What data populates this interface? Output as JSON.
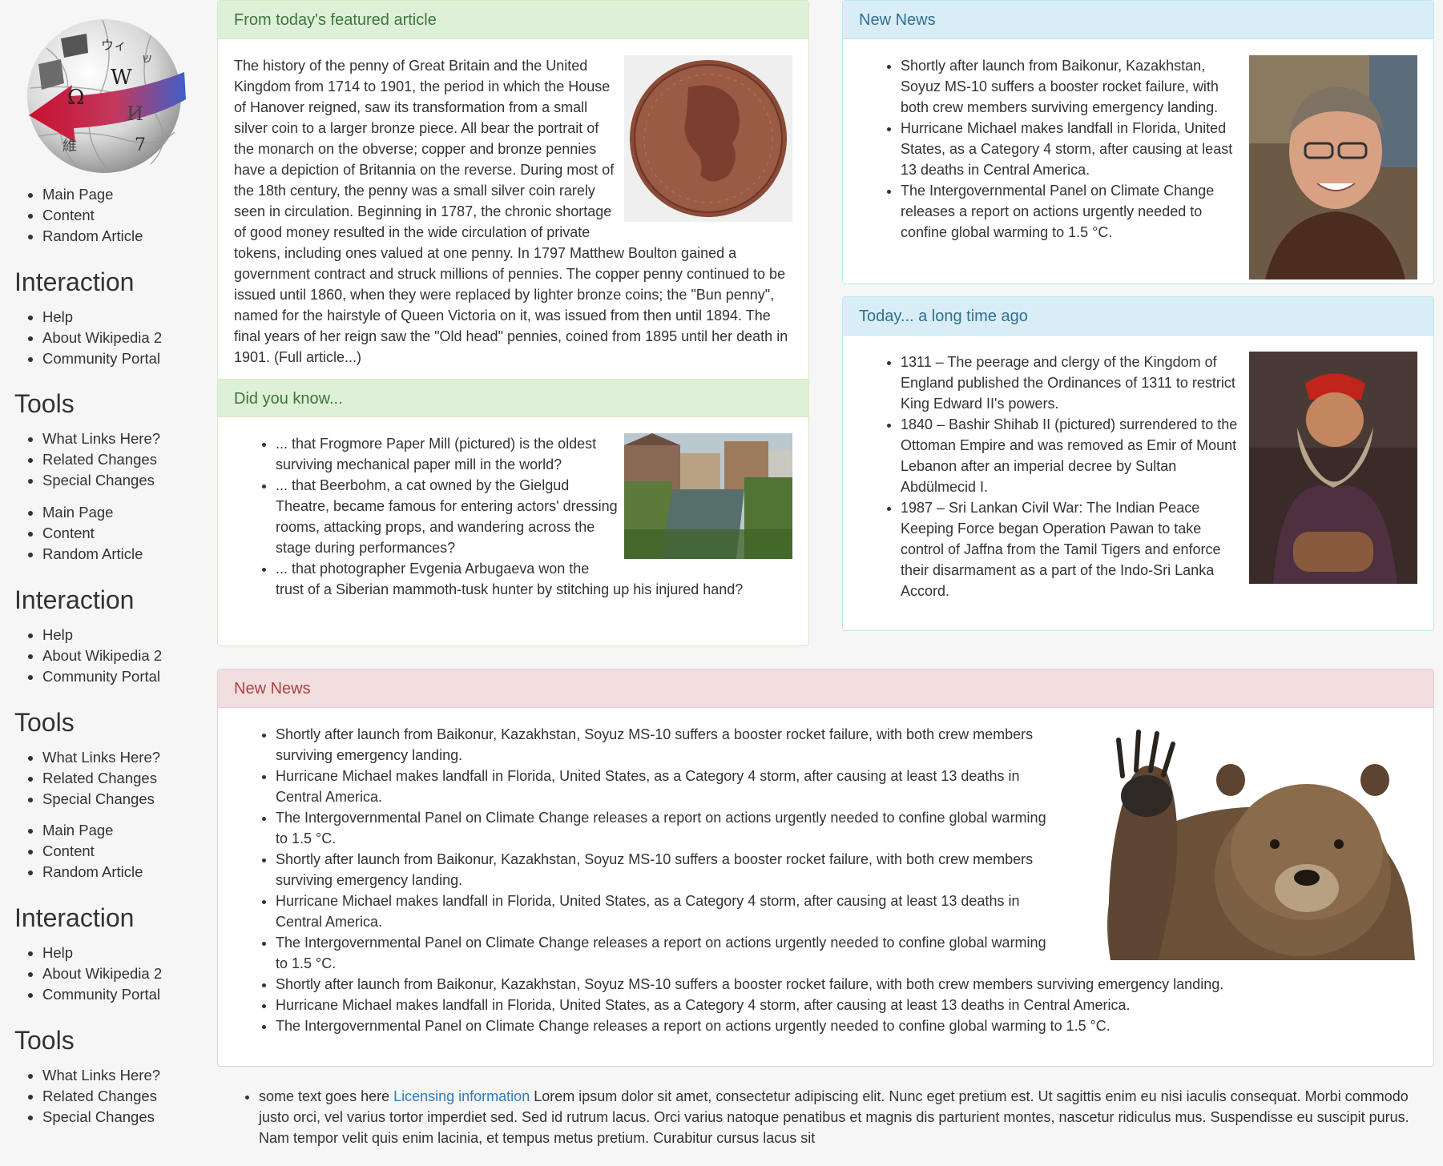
{
  "sidebar": {
    "groups": [
      {
        "links": [
          "Main Page",
          "Content",
          "Random Article"
        ],
        "interaction_title": "Interaction",
        "interaction_links": [
          "Help",
          "About Wikipedia 2",
          "Community Portal"
        ],
        "tools_title": "Tools",
        "tools_links": [
          "What Links Here?",
          "Related Changes",
          "Special Changes"
        ]
      },
      {
        "links": [
          "Main Page",
          "Content",
          "Random Article"
        ],
        "interaction_title": "Interaction",
        "interaction_links": [
          "Help",
          "About Wikipedia 2",
          "Community Portal"
        ],
        "tools_title": "Tools",
        "tools_links": [
          "What Links Here?",
          "Related Changes",
          "Special Changes"
        ]
      },
      {
        "links": [
          "Main Page",
          "Content",
          "Random Article"
        ],
        "interaction_title": "Interaction",
        "interaction_links": [
          "Help",
          "About Wikipedia 2",
          "Community Portal"
        ],
        "tools_title": "Tools",
        "tools_links": [
          "What Links Here?",
          "Related Changes",
          "Special Changes"
        ]
      }
    ]
  },
  "featured": {
    "title": "From today's featured article",
    "text": "The history of the penny of Great Britain and the United Kingdom from 1714 to 1901, the period in which the House of Hanover reigned, saw its transformation from a small silver coin to a larger bronze piece. All bear the portrait of the monarch on the obverse; copper and bronze pennies have a depiction of Britannia on the reverse. During most of the 18th century, the penny was a small silver coin rarely seen in circulation. Beginning in 1787, the chronic shortage of good money resulted in the wide circulation of private tokens, including ones valued at one penny. In 1797 Matthew Boulton gained a government contract and struck millions of pennies. The copper penny continued to be issued until 1860, when they were replaced by lighter bronze coins; the \"Bun penny\", named for the hairstyle of Queen Victoria on it, was issued from then until 1894. The final years of her reign saw the \"Old head\" pennies, coined from 1895 until her death in 1901. (Full article...)"
  },
  "dyk": {
    "title": "Did you know...",
    "items": [
      "... that Frogmore Paper Mill (pictured) is the oldest surviving mechanical paper mill in the world?",
      "... that Beerbohm, a cat owned by the Gielgud Theatre, became famous for entering actors' dressing rooms, attacking props, and wandering across the stage during performances?",
      "... that photographer Evgenia Arbugaeva won the trust of a Siberian mammoth-tusk hunter by stitching up his injured hand?"
    ]
  },
  "news": {
    "title": "New News",
    "items": [
      "Shortly after launch from Baikonur, Kazakhstan, Soyuz MS-10 suffers a booster rocket failure, with both crew members surviving emergency landing.",
      "Hurricane Michael makes landfall in Florida, United States, as a Category 4 storm, after causing at least 13 deaths in Central America.",
      "The Intergovernmental Panel on Climate Change releases a report on actions urgently needed to confine global warming to 1.5 °C."
    ]
  },
  "onthisday": {
    "title": "Today... a long time ago",
    "items": [
      "1311 – The peerage and clergy of the Kingdom of England published the Ordinances of 1311 to restrict King Edward II's powers.",
      "1840 – Bashir Shihab II (pictured) surrendered to the Ottoman Empire and was removed as Emir of Mount Lebanon after an imperial decree by Sultan Abdülmecid I.",
      "1987 – Sri Lankan Civil War: The Indian Peace Keeping Force began Operation Pawan to take control of Jaffna from the Tamil Tigers and enforce their disarmament as a part of the Indo-Sri Lanka Accord."
    ]
  },
  "news2": {
    "title": "New News",
    "items": [
      "Shortly after launch from Baikonur, Kazakhstan, Soyuz MS-10 suffers a booster rocket failure, with both crew members surviving emergency landing.",
      "Hurricane Michael makes landfall in Florida, United States, as a Category 4 storm, after causing at least 13 deaths in Central America.",
      "The Intergovernmental Panel on Climate Change releases a report on actions urgently needed to confine global warming to 1.5 °C.",
      "Shortly after launch from Baikonur, Kazakhstan, Soyuz MS-10 suffers a booster rocket failure, with both crew members surviving emergency landing.",
      "Hurricane Michael makes landfall in Florida, United States, as a Category 4 storm, after causing at least 13 deaths in Central America.",
      "The Intergovernmental Panel on Climate Change releases a report on actions urgently needed to confine global warming to 1.5 °C.",
      "Shortly after launch from Baikonur, Kazakhstan, Soyuz MS-10 suffers a booster rocket failure, with both crew members surviving emergency landing.",
      "Hurricane Michael makes landfall in Florida, United States, as a Category 4 storm, after causing at least 13 deaths in Central America.",
      "The Intergovernmental Panel on Climate Change releases a report on actions urgently needed to confine global warming to 1.5 °C."
    ]
  },
  "footer": {
    "prefix": "some text goes here",
    "link": "Licensing information",
    "text": "Lorem ipsum dolor sit amet, consectetur adipiscing elit. Nunc eget pretium est. Ut sagittis enim eu nisi iaculis consequat. Morbi commodo justo orci, vel varius tortor imperdiet sed. Sed id rutrum lacus. Orci varius natoque penatibus et magnis dis parturient montes, nascetur ridiculus mus. Suspendisse eu suscipit purus. Nam tempor velit quis enim lacinia, et tempus metus pretium. Curabitur cursus lacus sit"
  },
  "logo_glyphs": [
    "Ω",
    "W",
    "И",
    "ウィ",
    "維",
    "7",
    "ש"
  ]
}
